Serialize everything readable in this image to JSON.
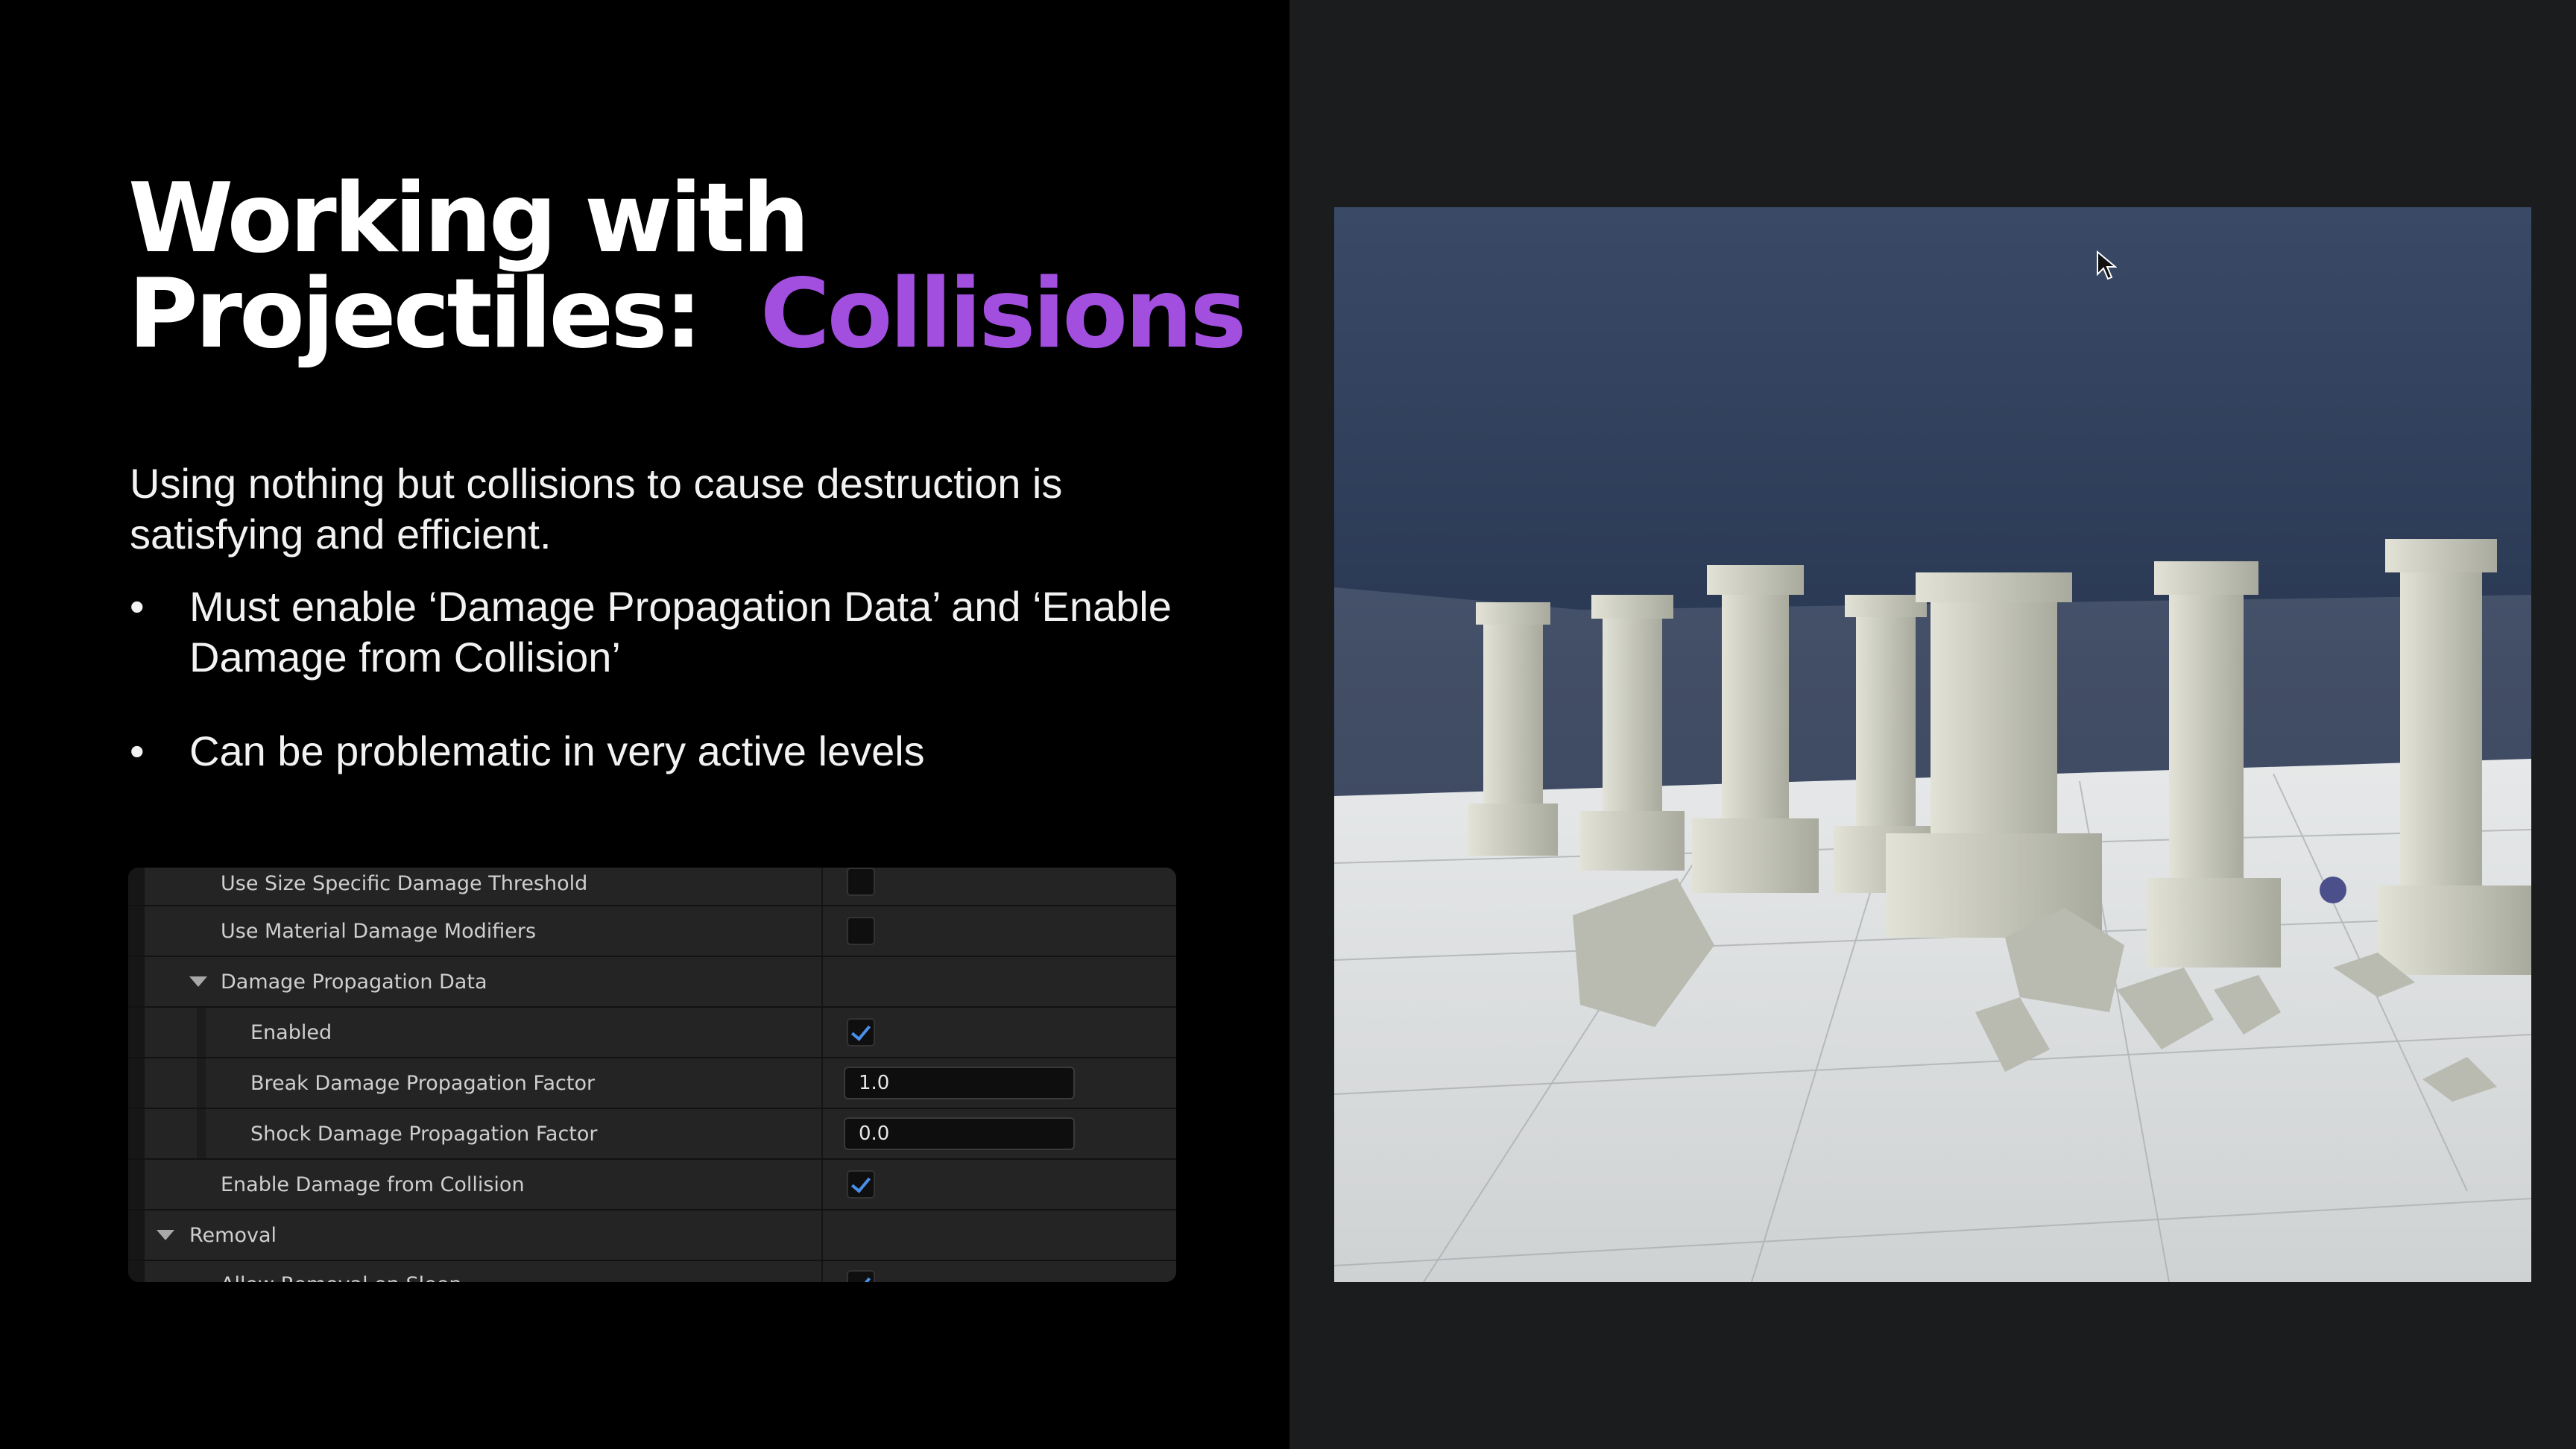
{
  "slide": {
    "title_line1": "Working with",
    "title_line2": "Projectiles:",
    "title_accent": "Collisions",
    "intro": "Using nothing but collisions to cause destruction is satisfying and efficient.",
    "bullets": [
      "Must enable ‘Damage Propagation Data’ and ‘Enable Damage from Collision’",
      "Can be problematic in very active levels"
    ],
    "bullet_glyph": "•"
  },
  "details_panel": {
    "rows": [
      {
        "label": "Use Size Specific Damage Threshold",
        "control": "checkbox",
        "checked": false
      },
      {
        "label": "Use Material Damage Modifiers",
        "control": "checkbox",
        "checked": false
      },
      {
        "label": "Damage Propagation Data",
        "control": "group",
        "expanded": true
      },
      {
        "label": "Enabled",
        "control": "checkbox",
        "checked": true
      },
      {
        "label": "Break Damage Propagation Factor",
        "control": "number",
        "value": "1.0"
      },
      {
        "label": "Shock Damage Propagation Factor",
        "control": "number",
        "value": "0.0"
      },
      {
        "label": "Enable Damage from Collision",
        "control": "checkbox",
        "checked": true
      },
      {
        "label": "Removal",
        "control": "group",
        "expanded": true
      },
      {
        "label": "Allow Removal on Sleep",
        "control": "checkbox",
        "checked": true
      }
    ]
  },
  "viewport": {
    "scene": "destructible-pillars-scene",
    "colors": {
      "sky": "#2b3a55",
      "floor": "#d8dadb",
      "statue": "#c9c9bd"
    }
  },
  "colors": {
    "accent": "#a24fe0",
    "checkmark": "#4a8fe8"
  }
}
